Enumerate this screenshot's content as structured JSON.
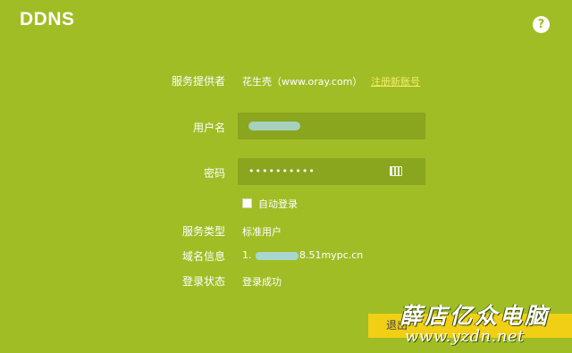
{
  "page": {
    "title": "DDNS",
    "help_icon": "question-mark-icon"
  },
  "form": {
    "provider": {
      "label": "服务提供者",
      "value": "花生壳（www.oray.com）",
      "link": "注册新账号"
    },
    "username": {
      "label": "用户名",
      "value": ""
    },
    "password": {
      "label": "密码",
      "value": "••••••••••",
      "icon": "keyboard-icon"
    },
    "auto_login": {
      "label": "自动登录",
      "checked": false
    },
    "service_type": {
      "label": "服务类型",
      "value": "标准用户"
    },
    "domain_info": {
      "label": "域名信息",
      "prefix": "1.",
      "suffix": "8.51mypc.cn"
    },
    "login_status": {
      "label": "登录状态",
      "value": "登录成功"
    }
  },
  "actions": {
    "logout_label": "退出"
  },
  "watermark": {
    "cn": "薛店亿众电脑",
    "url": "www.yzdn.net"
  },
  "colors": {
    "background": "#a0bd26",
    "field": "#8aa51e",
    "button": "#f0cf15",
    "link": "#f2ee6a"
  }
}
